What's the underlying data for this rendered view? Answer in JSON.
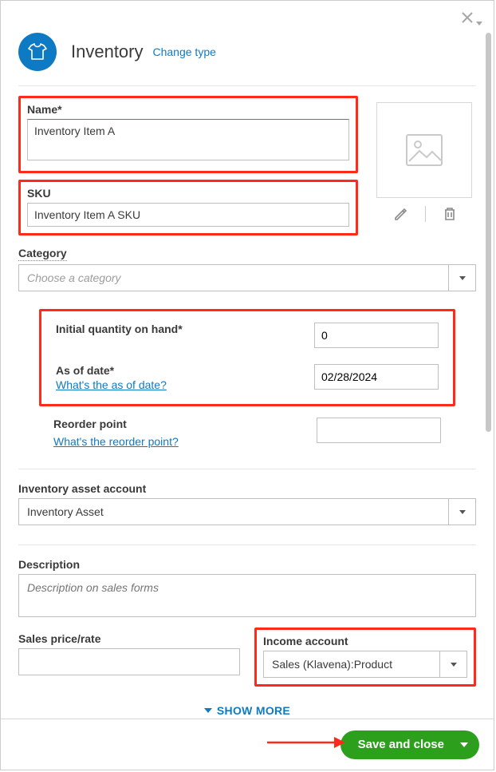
{
  "header": {
    "title": "Inventory",
    "change_type": "Change type"
  },
  "name": {
    "label": "Name*",
    "value": "Inventory Item A"
  },
  "sku": {
    "label": "SKU",
    "value": "Inventory Item A SKU"
  },
  "category": {
    "label": "Category",
    "placeholder": "Choose a category"
  },
  "initial_qty": {
    "label": "Initial quantity on hand*",
    "value": "0"
  },
  "as_of_date": {
    "label": "As of date*",
    "value": "02/28/2024",
    "help": "What's the as of date?"
  },
  "reorder": {
    "label": "Reorder point",
    "help": "What's the reorder point?",
    "value": ""
  },
  "asset_account": {
    "label": "Inventory asset account",
    "value": "Inventory Asset"
  },
  "description": {
    "label": "Description",
    "placeholder": "Description on sales forms"
  },
  "sales_price": {
    "label": "Sales price/rate",
    "value": ""
  },
  "income_account": {
    "label": "Income account",
    "value": "Sales (Klavena):Product"
  },
  "show_more": "SHOW MORE",
  "footer": {
    "save": "Save and close"
  }
}
